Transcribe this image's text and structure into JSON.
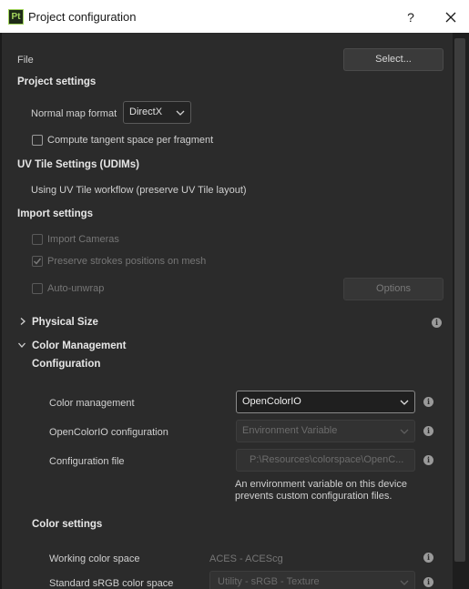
{
  "window": {
    "title": "Project configuration",
    "app_icon_text": "Pt",
    "help_label": "?"
  },
  "file": {
    "label": "File",
    "select_button": "Select..."
  },
  "project_settings": {
    "heading": "Project settings",
    "normal_map_label": "Normal map format",
    "normal_map_value": "DirectX",
    "tangent_label": "Compute tangent space per fragment",
    "tangent_checked": false
  },
  "uv_tile": {
    "heading": "UV Tile Settings (UDIMs)",
    "status": "Using UV Tile workflow (preserve UV Tile layout)"
  },
  "import_settings": {
    "heading": "Import settings",
    "import_cameras": "Import Cameras",
    "preserve_strokes": "Preserve strokes positions on mesh",
    "auto_unwrap": "Auto-unwrap",
    "options_button": "Options"
  },
  "physical_size": {
    "heading": "Physical Size"
  },
  "color_management": {
    "heading": "Color Management",
    "configuration_heading": "Configuration",
    "cm_label": "Color management",
    "cm_value": "OpenColorIO",
    "ocio_label": "OpenColorIO configuration",
    "ocio_value": "Environment Variable",
    "config_file_label": "Configuration file",
    "config_file_value": "P:\\Resources\\colorspace\\OpenC...",
    "env_note_line1": "An environment variable on this device",
    "env_note_line2": "prevents custom configuration files.",
    "color_settings_heading": "Color settings",
    "working_label": "Working color space",
    "working_value": "ACES - ACEScg",
    "srgb_label": "Standard sRGB color space",
    "srgb_value": "Utility - sRGB - Texture"
  },
  "icons": {
    "info": "i"
  }
}
